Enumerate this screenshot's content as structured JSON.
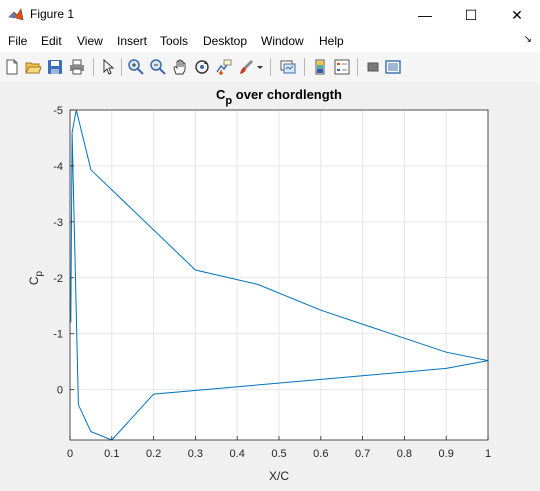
{
  "window": {
    "title": "Figure 1",
    "minimize_glyph": "—",
    "maximize_glyph": "☐",
    "close_glyph": "✕"
  },
  "menu": {
    "items": [
      "File",
      "Edit",
      "View",
      "Insert",
      "Tools",
      "Desktop",
      "Window",
      "Help"
    ],
    "dock_glyph": "↘"
  },
  "toolbar": {
    "icons": [
      "new-figure-icon",
      "open-file-icon",
      "save-icon",
      "print-icon",
      "select-arrow-icon",
      "zoom-in-icon",
      "zoom-out-icon",
      "pan-hand-icon",
      "rotate-3d-icon",
      "data-cursor-icon",
      "brush-icon",
      "brush-dropdown-icon",
      "link-plot-icon",
      "insert-colorbar-icon",
      "insert-legend-icon",
      "hide-plot-tools-icon",
      "show-plot-tools-icon"
    ]
  },
  "chart_data": {
    "type": "line",
    "title": "C",
    "title_sub": "p",
    "title_rest": " over chordlength",
    "xlabel": "X/C",
    "ylabel": "C",
    "ylabel_sub": "p",
    "xlim": [
      0,
      1
    ],
    "ylim": [
      -5,
      0.9
    ],
    "y_reversed": true,
    "grid": true,
    "xticks": [
      "0",
      "0.1",
      "0.2",
      "0.3",
      "0.4",
      "0.5",
      "0.6",
      "0.7",
      "0.8",
      "0.9",
      "1"
    ],
    "xtick_values": [
      0,
      0.1,
      0.2,
      0.3,
      0.4,
      0.5,
      0.6,
      0.7,
      0.8,
      0.9,
      1
    ],
    "yticks": [
      "-5",
      "-4",
      "-3",
      "-2",
      "-1",
      "0"
    ],
    "ytick_values": [
      -5,
      -4,
      -3,
      -2,
      -1,
      0
    ],
    "line_color": "#0072bd",
    "series": [
      {
        "x": [
          1.0,
          0.9,
          0.6,
          0.45,
          0.3,
          0.05,
          0.015,
          0.005,
          0.002,
          0.005,
          0.02,
          0.05,
          0.1,
          0.2,
          0.9,
          1.0
        ],
        "y": [
          -0.52,
          -0.67,
          -1.42,
          -1.88,
          -2.14,
          -3.93,
          -5.0,
          -4.6,
          -1.2,
          -4.6,
          0.27,
          0.75,
          0.9,
          0.08,
          -0.38,
          -0.52
        ]
      }
    ]
  }
}
